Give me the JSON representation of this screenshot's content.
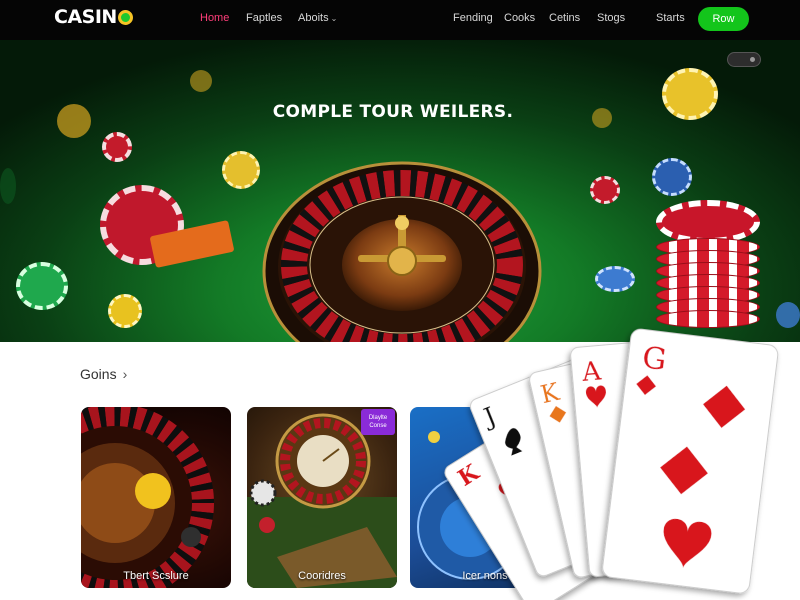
{
  "brand": {
    "name": "CASIN"
  },
  "nav": {
    "items": [
      {
        "label": "Home",
        "active": true
      },
      {
        "label": "Faptles",
        "active": false
      },
      {
        "label": "Aboits",
        "active": false,
        "has_dropdown": true
      },
      {
        "label": "Fending",
        "active": false
      },
      {
        "label": "Cooks",
        "active": false
      },
      {
        "label": "Cetins",
        "active": false
      },
      {
        "label": "Stogs",
        "active": false
      },
      {
        "label": "Starts",
        "active": false
      }
    ],
    "cta_label": "Row"
  },
  "hero": {
    "title": "COMPLE TOUR WEILERS."
  },
  "section": {
    "title": "Goins"
  },
  "tiles": [
    {
      "label": "Tbert Scslure",
      "icon": "roulette-wheel"
    },
    {
      "label": "Cooridres",
      "icon": "roulette-table",
      "badge": "Dlaylte Conse"
    },
    {
      "label": "Icer nons",
      "icon": "blue-game"
    }
  ],
  "colors": {
    "accent": "#ff3e7a",
    "cta": "#13c51b",
    "felt": "#137a26",
    "nav_bg": "#050505"
  }
}
